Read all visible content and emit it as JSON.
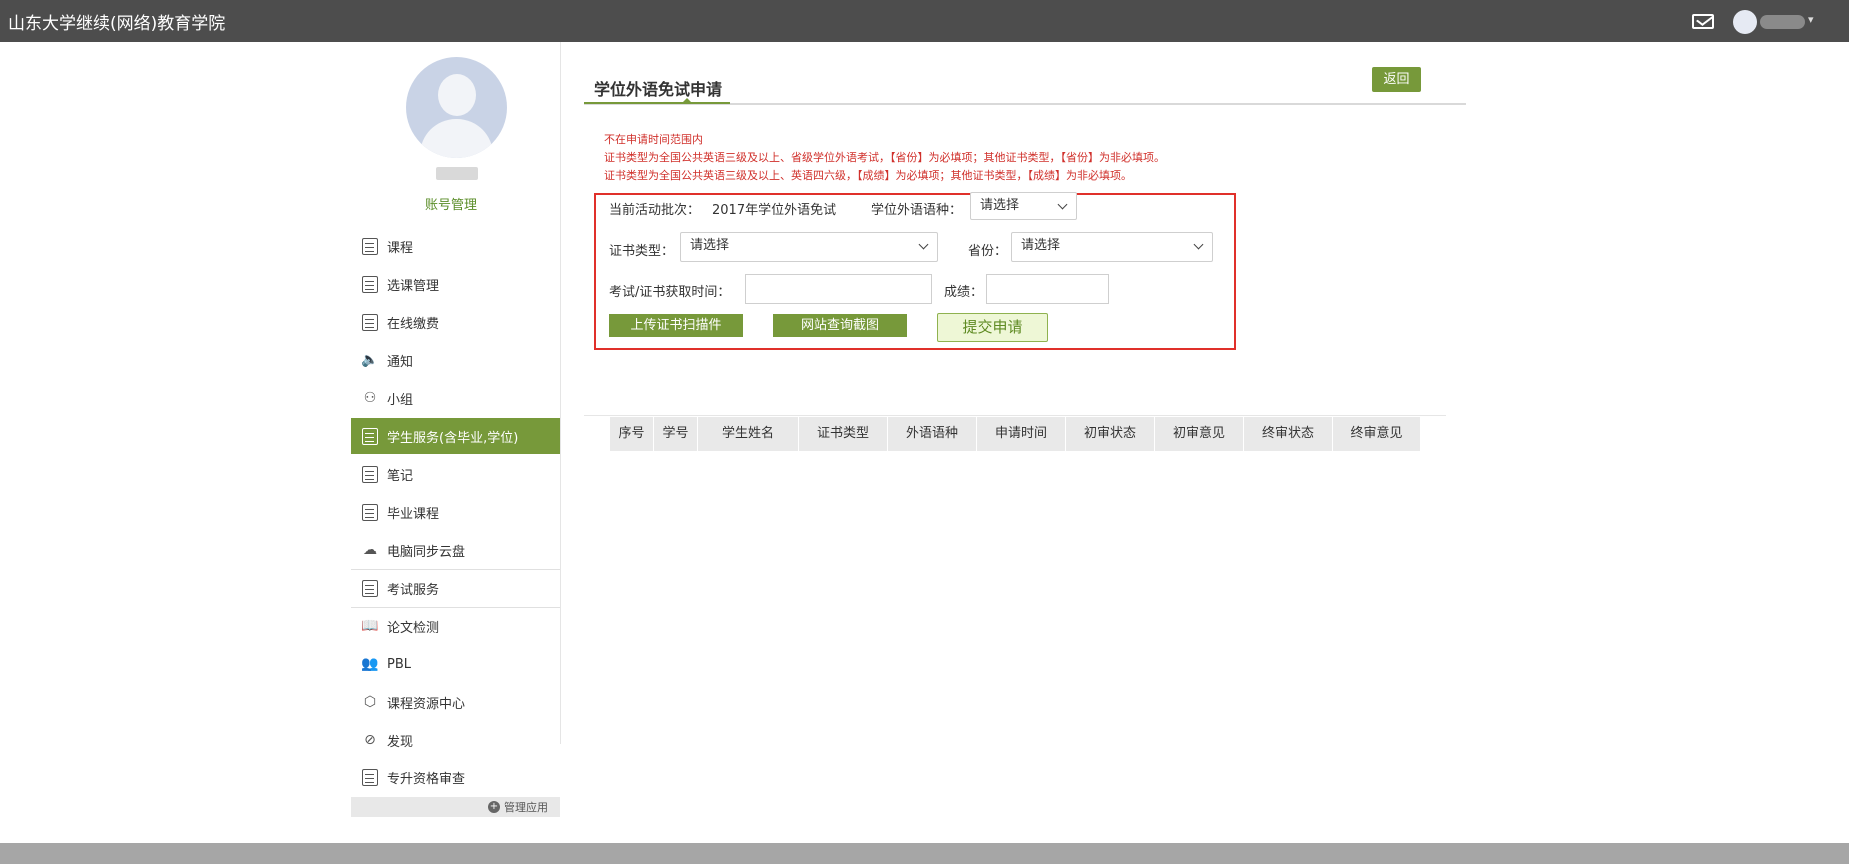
{
  "header": {
    "brand": "山东大学继续(网络)教育学院",
    "mail_icon": "mail-icon",
    "avatar_icon": "user-avatar-icon"
  },
  "sidebar": {
    "account_label": "账号管理",
    "items": [
      {
        "label": "课程",
        "icon": "calendar-icon"
      },
      {
        "label": "选课管理",
        "icon": "calendar-icon"
      },
      {
        "label": "在线缴费",
        "icon": "list-icon"
      },
      {
        "label": "通知",
        "icon": "speaker-icon"
      },
      {
        "label": "小组",
        "icon": "group-icon"
      },
      {
        "label": "学生服务(含毕业,学位)",
        "icon": "id-card-icon",
        "active": true
      },
      {
        "label": "笔记",
        "icon": "note-icon"
      },
      {
        "label": "毕业课程",
        "icon": "list-icon"
      },
      {
        "label": "电脑同步云盘",
        "icon": "cloud-icon"
      },
      {
        "label": "考试服务",
        "icon": "exam-icon"
      },
      {
        "label": "论文检测",
        "icon": "book-icon"
      },
      {
        "label": "PBL",
        "icon": "people-icon"
      },
      {
        "label": "课程资源中心",
        "icon": "cube-icon"
      },
      {
        "label": "发现",
        "icon": "compass-icon"
      },
      {
        "label": "专升资格审查",
        "icon": "check-doc-icon"
      }
    ],
    "manage_label": "管理应用"
  },
  "main": {
    "title": "学位外语免试申请",
    "back_label": "返回",
    "notices": [
      "不在申请时间范围内",
      "证书类型为全国公共英语三级及以上、省级学位外语考试，【省份】为必填项；其他证书类型，【省份】为非必填项。",
      "证书类型为全国公共英语三级及以上、英语四六级，【成绩】为必填项；其他证书类型，【成绩】为非必填项。"
    ],
    "form": {
      "batch_label": "当前活动批次：",
      "batch_value": "2017年学位外语免试",
      "language_label": "学位外语语种：",
      "language_value": "请选择",
      "cert_type_label": "证书类型：",
      "cert_type_value": "请选择",
      "province_label": "省份：",
      "province_value": "请选择",
      "exam_time_label": "考试/证书获取时间：",
      "exam_time_value": "",
      "score_label": "成绩：",
      "score_value": "",
      "upload_label": "上传证书扫描件",
      "screenshot_label": "网站查询截图",
      "submit_label": "提交申请"
    },
    "table": {
      "columns": [
        "序号",
        "学号",
        "学生姓名",
        "证书类型",
        "外语语种",
        "申请时间",
        "初审状态",
        "初审意见",
        "终审状态",
        "终审意见"
      ]
    }
  }
}
